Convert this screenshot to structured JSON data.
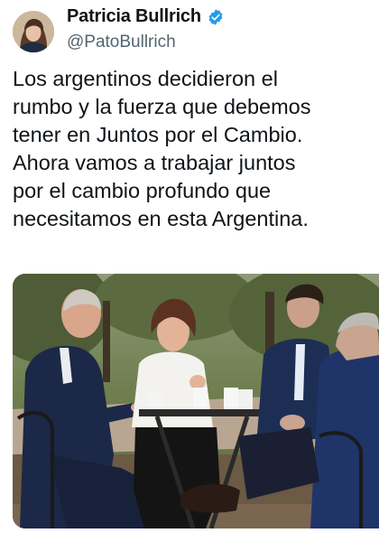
{
  "tweet": {
    "author": {
      "display_name": "Patricia Bullrich",
      "handle": "@PatoBullrich",
      "verified": true,
      "avatar_icon": "profile-photo"
    },
    "text_lines": [
      "Los argentinos decidieron el",
      "rumbo y la fuerza que debemos",
      "tener en Juntos por el Cambio.",
      "Ahora vamos a trabajar juntos",
      "por el cambio profundo que",
      "necesitamos en esta Argentina."
    ],
    "media": {
      "type": "photo",
      "description_icon": "photo-four-people-at-outdoor-table"
    }
  },
  "colors": {
    "verified_badge": "#1d9bf0",
    "handle_text": "#536471",
    "body_text": "#0f1419"
  }
}
